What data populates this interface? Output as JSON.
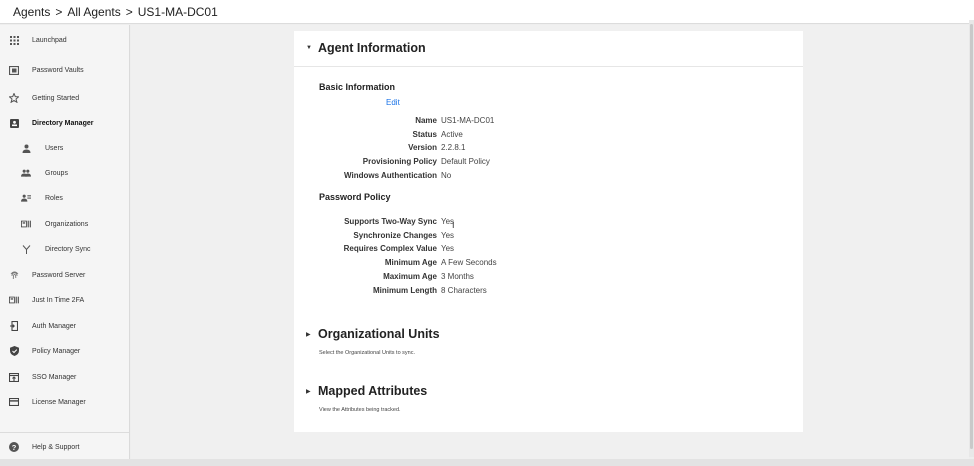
{
  "breadcrumb": {
    "items": [
      "Agents",
      "All Agents",
      "US1-MA-DC01"
    ],
    "separator": ">"
  },
  "sidebar": {
    "items": [
      {
        "label": "Launchpad",
        "icon": "grid-icon",
        "sub": false,
        "active": false
      },
      {
        "label": "Password Vaults",
        "icon": "vault-icon",
        "sub": false,
        "active": false
      },
      {
        "label": "Getting Started",
        "icon": "star-icon",
        "sub": false,
        "active": false
      },
      {
        "label": "Directory Manager",
        "icon": "contact-card-icon",
        "sub": false,
        "active": true
      },
      {
        "label": "Users",
        "icon": "user-icon",
        "sub": true,
        "active": false
      },
      {
        "label": "Groups",
        "icon": "group-icon",
        "sub": true,
        "active": false
      },
      {
        "label": "Roles",
        "icon": "roles-icon",
        "sub": true,
        "active": false
      },
      {
        "label": "Organizations",
        "icon": "org-icon",
        "sub": true,
        "active": false
      },
      {
        "label": "Directory Sync",
        "icon": "sync-fork-icon",
        "sub": true,
        "active": false
      },
      {
        "label": "Password Server",
        "icon": "fingerprint-icon",
        "sub": false,
        "active": false
      },
      {
        "label": "Just In Time 2FA",
        "icon": "badge-icon",
        "sub": false,
        "active": false
      },
      {
        "label": "Auth Manager",
        "icon": "login-icon",
        "sub": false,
        "active": false
      },
      {
        "label": "Policy Manager",
        "icon": "shield-icon",
        "sub": false,
        "active": false
      },
      {
        "label": "SSO Manager",
        "icon": "sso-window-icon",
        "sub": false,
        "active": false
      },
      {
        "label": "License Manager",
        "icon": "credit-card-icon",
        "sub": false,
        "active": false
      }
    ],
    "help": {
      "label": "Help & Support",
      "icon": "help-icon"
    }
  },
  "agent_info": {
    "title": "Agent Information",
    "basic": {
      "heading": "Basic Information",
      "edit_label": "Edit",
      "rows": [
        {
          "key": "Name",
          "value": "US1-MA-DC01"
        },
        {
          "key": "Status",
          "value": "Active"
        },
        {
          "key": "Version",
          "value": "2.2.8.1"
        },
        {
          "key": "Provisioning Policy",
          "value": "Default Policy"
        },
        {
          "key": "Windows Authentication",
          "value": "No"
        }
      ]
    },
    "password_policy": {
      "heading": "Password Policy",
      "rows": [
        {
          "key": "Supports Two-Way Sync",
          "value": "Yes"
        },
        {
          "key": "Synchronize Changes",
          "value": "Yes"
        },
        {
          "key": "Requires Complex Value",
          "value": "Yes"
        },
        {
          "key": "Minimum Age",
          "value": "A Few Seconds"
        },
        {
          "key": "Maximum Age",
          "value": "3 Months"
        },
        {
          "key": "Minimum Length",
          "value": "8 Characters"
        }
      ]
    }
  },
  "org_units": {
    "title": "Organizational Units",
    "description": "Select the Organizational Units to sync."
  },
  "mapped_attrs": {
    "title": "Mapped Attributes",
    "description": "View the Attributes being tracked."
  },
  "colors": {
    "link": "#1a73e8",
    "sidebar_bg": "#f5f5f5",
    "page_bg": "#f0f0f0"
  }
}
